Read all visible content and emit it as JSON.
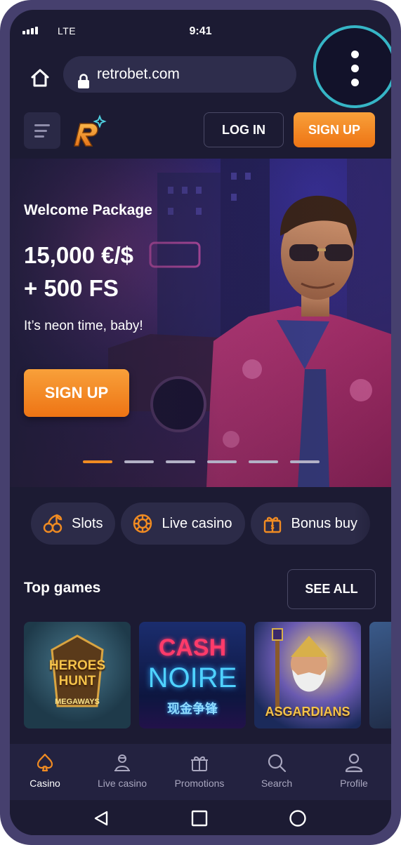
{
  "status_bar": {
    "network": "LTE",
    "time": "9:41"
  },
  "browser": {
    "url": "retrobet.com"
  },
  "header": {
    "login_label": "LOG IN",
    "signup_label": "SIGN UP"
  },
  "hero": {
    "title": "Welcome Package",
    "amount_line1": "15,000 €/$",
    "amount_line2": "+ 500 FS",
    "tagline": "It’s neon time, baby!",
    "cta_label": "SIGN UP",
    "slide_count": 6,
    "active_slide": 1
  },
  "categories": [
    {
      "label": "Slots",
      "icon": "cherry-icon"
    },
    {
      "label": "Live casino",
      "icon": "chip-icon"
    },
    {
      "label": "Bonus buy",
      "icon": "gift-box-icon"
    }
  ],
  "top_games": {
    "title": "Top games",
    "see_all_label": "SEE ALL",
    "games": [
      {
        "name_line1": "HEROES",
        "name_line2": "HUNT",
        "name_line3": "MEGAWAYS"
      },
      {
        "name_line1": "CASH",
        "name_line2": "NOIRE",
        "name_line3": "现金争锋"
      },
      {
        "name_line1": "ASGARDIANS"
      }
    ]
  },
  "bottom_nav": [
    {
      "label": "Casino",
      "icon": "spade-icon",
      "active": true
    },
    {
      "label": "Live casino",
      "icon": "dealer-icon",
      "active": false
    },
    {
      "label": "Promotions",
      "icon": "gift-icon",
      "active": false
    },
    {
      "label": "Search",
      "icon": "search-icon",
      "active": false
    },
    {
      "label": "Profile",
      "icon": "user-icon",
      "active": false
    }
  ],
  "colors": {
    "accent": "#f08b22",
    "background": "#1c1b33",
    "highlight_ring": "#36b5c6"
  }
}
